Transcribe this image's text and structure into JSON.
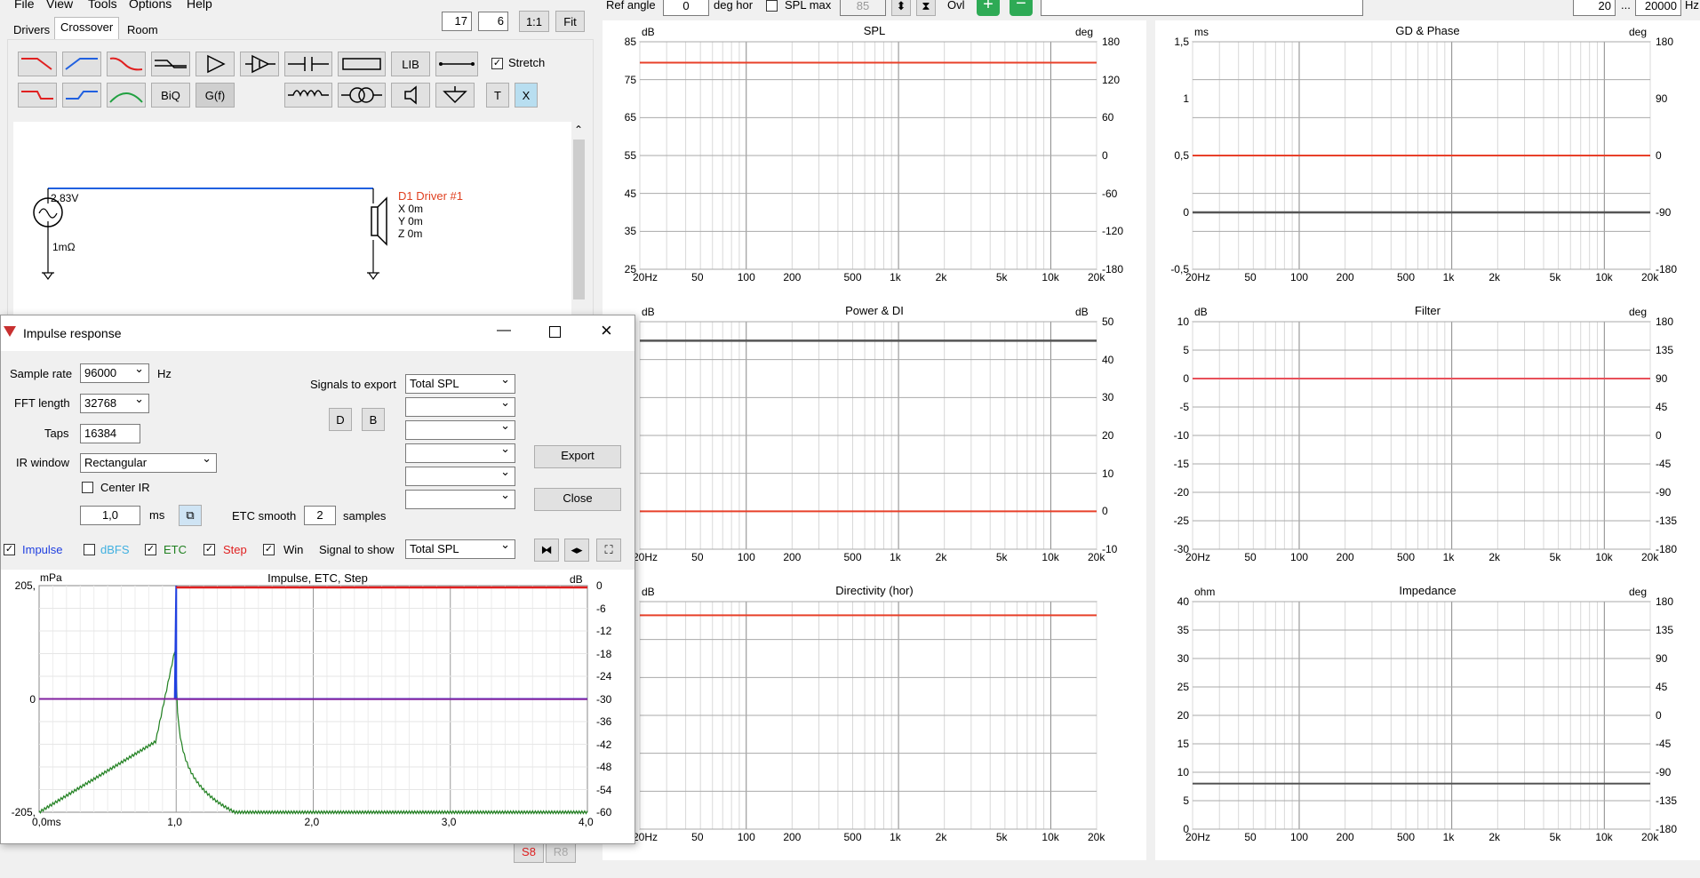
{
  "menu": [
    "File",
    "View",
    "Tools",
    "Options",
    "Help"
  ],
  "tabs": [
    "Drivers",
    "Crossover",
    "Room"
  ],
  "zoom": {
    "a": "17",
    "b": "6",
    "one": "1:1",
    "fit": "Fit"
  },
  "toolbar": {
    "lib": "LIB",
    "stretch": "Stretch",
    "biq": "BiQ",
    "gf": "G(f)",
    "t": "T",
    "x": "X"
  },
  "schematic": {
    "voltage": "2,83V",
    "resistance": "1mΩ",
    "driver": "D1 Driver #1",
    "x": "X 0m",
    "y": "Y 0m",
    "z": "Z 0m"
  },
  "topbar": {
    "ref_angle_label": "Ref angle",
    "ref_angle": "0",
    "deg_hor": "deg hor",
    "spl_max": "SPL max",
    "spl_max_val": "85",
    "ovl": "Ovl",
    "f_lo": "20",
    "dots": "...",
    "f_hi": "20000",
    "hz": "Hz"
  },
  "dialog": {
    "title": "Impulse response",
    "sample_rate_label": "Sample rate",
    "sample_rate": "96000",
    "hz": "Hz",
    "fft_label": "FFT length",
    "fft": "32768",
    "taps_label": "Taps",
    "taps": "16384",
    "irwin_label": "IR window",
    "irwin": "Rectangular",
    "center_ir": "Center IR",
    "ms_val": "1,0",
    "ms": "ms",
    "etc_smooth": "ETC smooth",
    "etc_val": "2",
    "samples": "samples",
    "signals_export": "Signals to export",
    "export_sel": "Total SPL",
    "d": "D",
    "b": "B",
    "export": "Export",
    "close": "Close",
    "impulse": "Impulse",
    "dbfs": "dBFS",
    "etc": "ETC",
    "step": "Step",
    "win": "Win",
    "signal_show": "Signal to show",
    "signal_show_val": "Total SPL"
  },
  "status": {
    "s8": "S8",
    "r8": "R8"
  },
  "freq_ticks": [
    "20Hz",
    "50",
    "100",
    "200",
    "500",
    "1k",
    "2k",
    "5k",
    "10k",
    "20k"
  ],
  "charts": [
    {
      "title": "SPL",
      "lunit": "dB",
      "runit": "deg",
      "left": [
        "85",
        "75",
        "65",
        "55",
        "45",
        "35",
        "25"
      ],
      "right": [
        "180",
        "120",
        "60",
        "0",
        "-60",
        "-120",
        "-180"
      ],
      "trace": "#e8402a",
      "tracey": 79.5,
      "lmin": 25,
      "lmax": 85
    },
    {
      "title": "GD & Phase",
      "lunit": "ms",
      "runit": "deg",
      "left": [
        "1,5",
        "1",
        "0,5",
        "0",
        "-0,5"
      ],
      "right": [
        "180",
        "90",
        "0",
        "-90",
        "-180"
      ],
      "trace": "#e8402a",
      "tracey": 0.5,
      "lmin": -0.5,
      "lmax": 1.5,
      "trace2": "#555",
      "trace2y": 0
    },
    {
      "title": "Power & DI",
      "lunit": "dB",
      "runit": "dB",
      "left": [],
      "right": [
        "50",
        "40",
        "30",
        "20",
        "10",
        "0",
        "-10"
      ],
      "trace": "#e8402a",
      "tracey": 0,
      "lmin": -10,
      "lmax": 50,
      "trace2": "#555",
      "trace2y": 45
    },
    {
      "title": "Filter",
      "lunit": "dB",
      "runit": "deg",
      "left": [
        "10",
        "5",
        "0",
        "-5",
        "-10",
        "-15",
        "-20",
        "-25",
        "-30"
      ],
      "right": [
        "180",
        "135",
        "90",
        "45",
        "0",
        "-45",
        "-90",
        "-135",
        "-180"
      ],
      "trace": "#e8505a",
      "tracey": 0,
      "lmin": -30,
      "lmax": 10
    },
    {
      "title": "Directivity (hor)",
      "lunit": "dB",
      "runit": "",
      "left": [],
      "right": [],
      "trace": "#e8402a",
      "tracey": 0.94,
      "lmin": 0,
      "lmax": 1
    },
    {
      "title": "Impedance",
      "lunit": "ohm",
      "runit": "deg",
      "left": [
        "40",
        "35",
        "30",
        "25",
        "20",
        "15",
        "10",
        "5",
        "0"
      ],
      "right": [
        "180",
        "135",
        "90",
        "45",
        "0",
        "-45",
        "-90",
        "-135",
        "-180"
      ],
      "trace": "#555",
      "tracey": 8,
      "lmin": 0,
      "lmax": 40
    }
  ],
  "ir_chart": {
    "title": "Impulse, ETC, Step",
    "lunit": "mPa",
    "runit": "dB",
    "left": [
      "205,",
      "0",
      "-205,"
    ],
    "right": [
      "0",
      "-6",
      "-12",
      "-18",
      "-24",
      "-30",
      "-36",
      "-42",
      "-48",
      "-54",
      "-60"
    ],
    "x": [
      "0,0ms",
      "1,0",
      "2,0",
      "3,0",
      "4,0"
    ]
  },
  "chart_data": {
    "type": "line",
    "title": "Impulse, ETC, Step",
    "xlabel": "ms",
    "ylabel": "mPa",
    "xlim": [
      0,
      4
    ],
    "ylim": [
      -205,
      205
    ],
    "series": [
      {
        "name": "Impulse",
        "values": [
          [
            0,
            0
          ],
          [
            0.99,
            0
          ],
          [
            1.0,
            205
          ],
          [
            1.0,
            0
          ],
          [
            4,
            0
          ]
        ]
      },
      {
        "name": "Step",
        "values": [
          [
            0,
            0
          ],
          [
            0.99,
            0
          ],
          [
            1.0,
            0
          ],
          [
            1.0,
            -0.5
          ],
          [
            4,
            -0.5
          ]
        ]
      }
    ]
  }
}
